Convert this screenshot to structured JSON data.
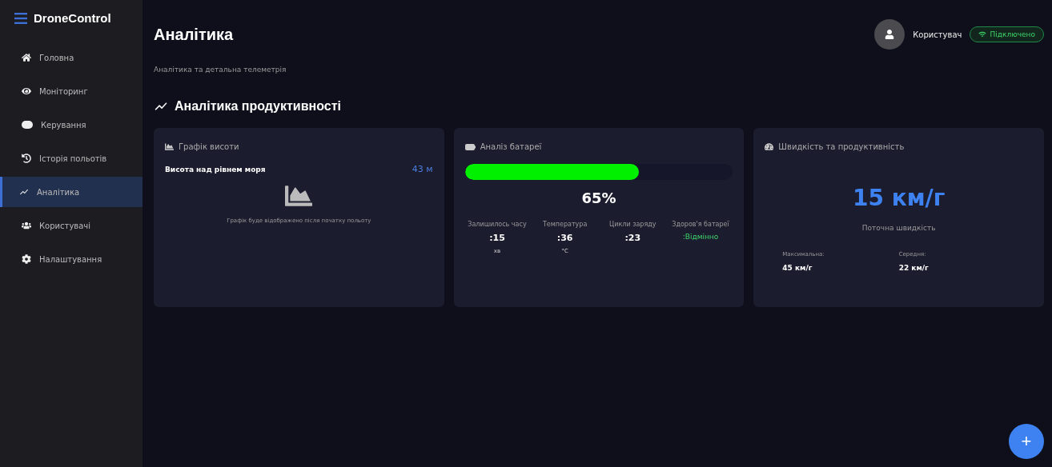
{
  "sidebar": {
    "brand": "DroneControl",
    "items": [
      {
        "label": "Головна",
        "selected": false
      },
      {
        "label": "Моніторинг",
        "selected": false
      },
      {
        "label": "Керування",
        "selected": false
      },
      {
        "label": "Історія польотів",
        "selected": false
      },
      {
        "label": "Аналітика",
        "selected": true
      },
      {
        "label": "Користувачі",
        "selected": false
      },
      {
        "label": "Налаштування",
        "selected": false
      }
    ]
  },
  "header": {
    "title": "Аналітика",
    "user": "Користувач",
    "status": "Підключено"
  },
  "subtitle": "Аналітика та детальна телеметрія",
  "section_title": "Аналітика продуктивності",
  "altitude_card": {
    "title": "Графік висоти",
    "label": "Висота над рівнем моря",
    "value": "43 м",
    "note": "Графік буде відображено після початку польоту"
  },
  "battery_card": {
    "title": "Аналіз батареї",
    "level": 0.65,
    "percent": "65%",
    "stats": [
      {
        "label": "Залишилось часу",
        "value": ":15",
        "unit": "хв",
        "good": false
      },
      {
        "label": "Температура",
        "value": ":36",
        "unit": "°C",
        "good": false
      },
      {
        "label": "Цикли заряду",
        "value": ":23",
        "good": false
      },
      {
        "label": "Здоров'я батареї",
        "value": ":Відмінно",
        "good": true
      }
    ]
  },
  "speed_card": {
    "title": "Швидкість та продуктивність",
    "value": "15 км/г",
    "caption": "Поточна швидкість",
    "stats": [
      {
        "label": "Максимальна:",
        "value": "45 км/г"
      },
      {
        "label": "Середня:",
        "value": "22 км/г"
      }
    ]
  },
  "fab": "+"
}
